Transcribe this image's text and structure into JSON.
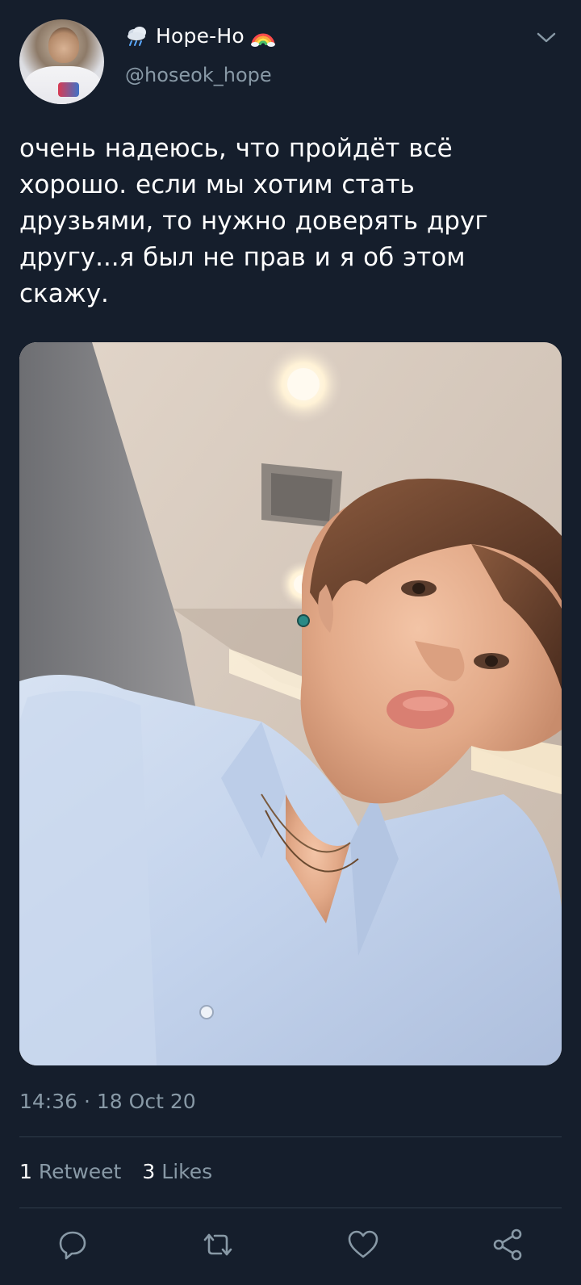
{
  "tweet": {
    "display_name": "Hope-Ho",
    "handle": "@hoseok_hope",
    "text": "очень надеюсь, что пройдёт всё\nхорошо. если мы хотим стать\nдрузьями, то нужно доверять друг\nдругу...я был не прав и я об этом\nскажу.",
    "timestamp": "14:36 · 18 Oct 20",
    "retweets": {
      "count": "1",
      "label": "Retweet"
    },
    "likes": {
      "count": "3",
      "label": "Likes"
    }
  },
  "icons": {
    "name_prefix": "cloud-with-rain-icon",
    "name_suffix": "rainbow-icon",
    "menu": "chevron-down-icon",
    "reply": "reply-icon",
    "retweet": "retweet-icon",
    "like": "heart-icon",
    "share": "share-icon"
  },
  "colors": {
    "background": "#151e2c",
    "secondary_text": "#8899a6",
    "divider": "#2f3c4a",
    "icon": "#8899a6"
  }
}
